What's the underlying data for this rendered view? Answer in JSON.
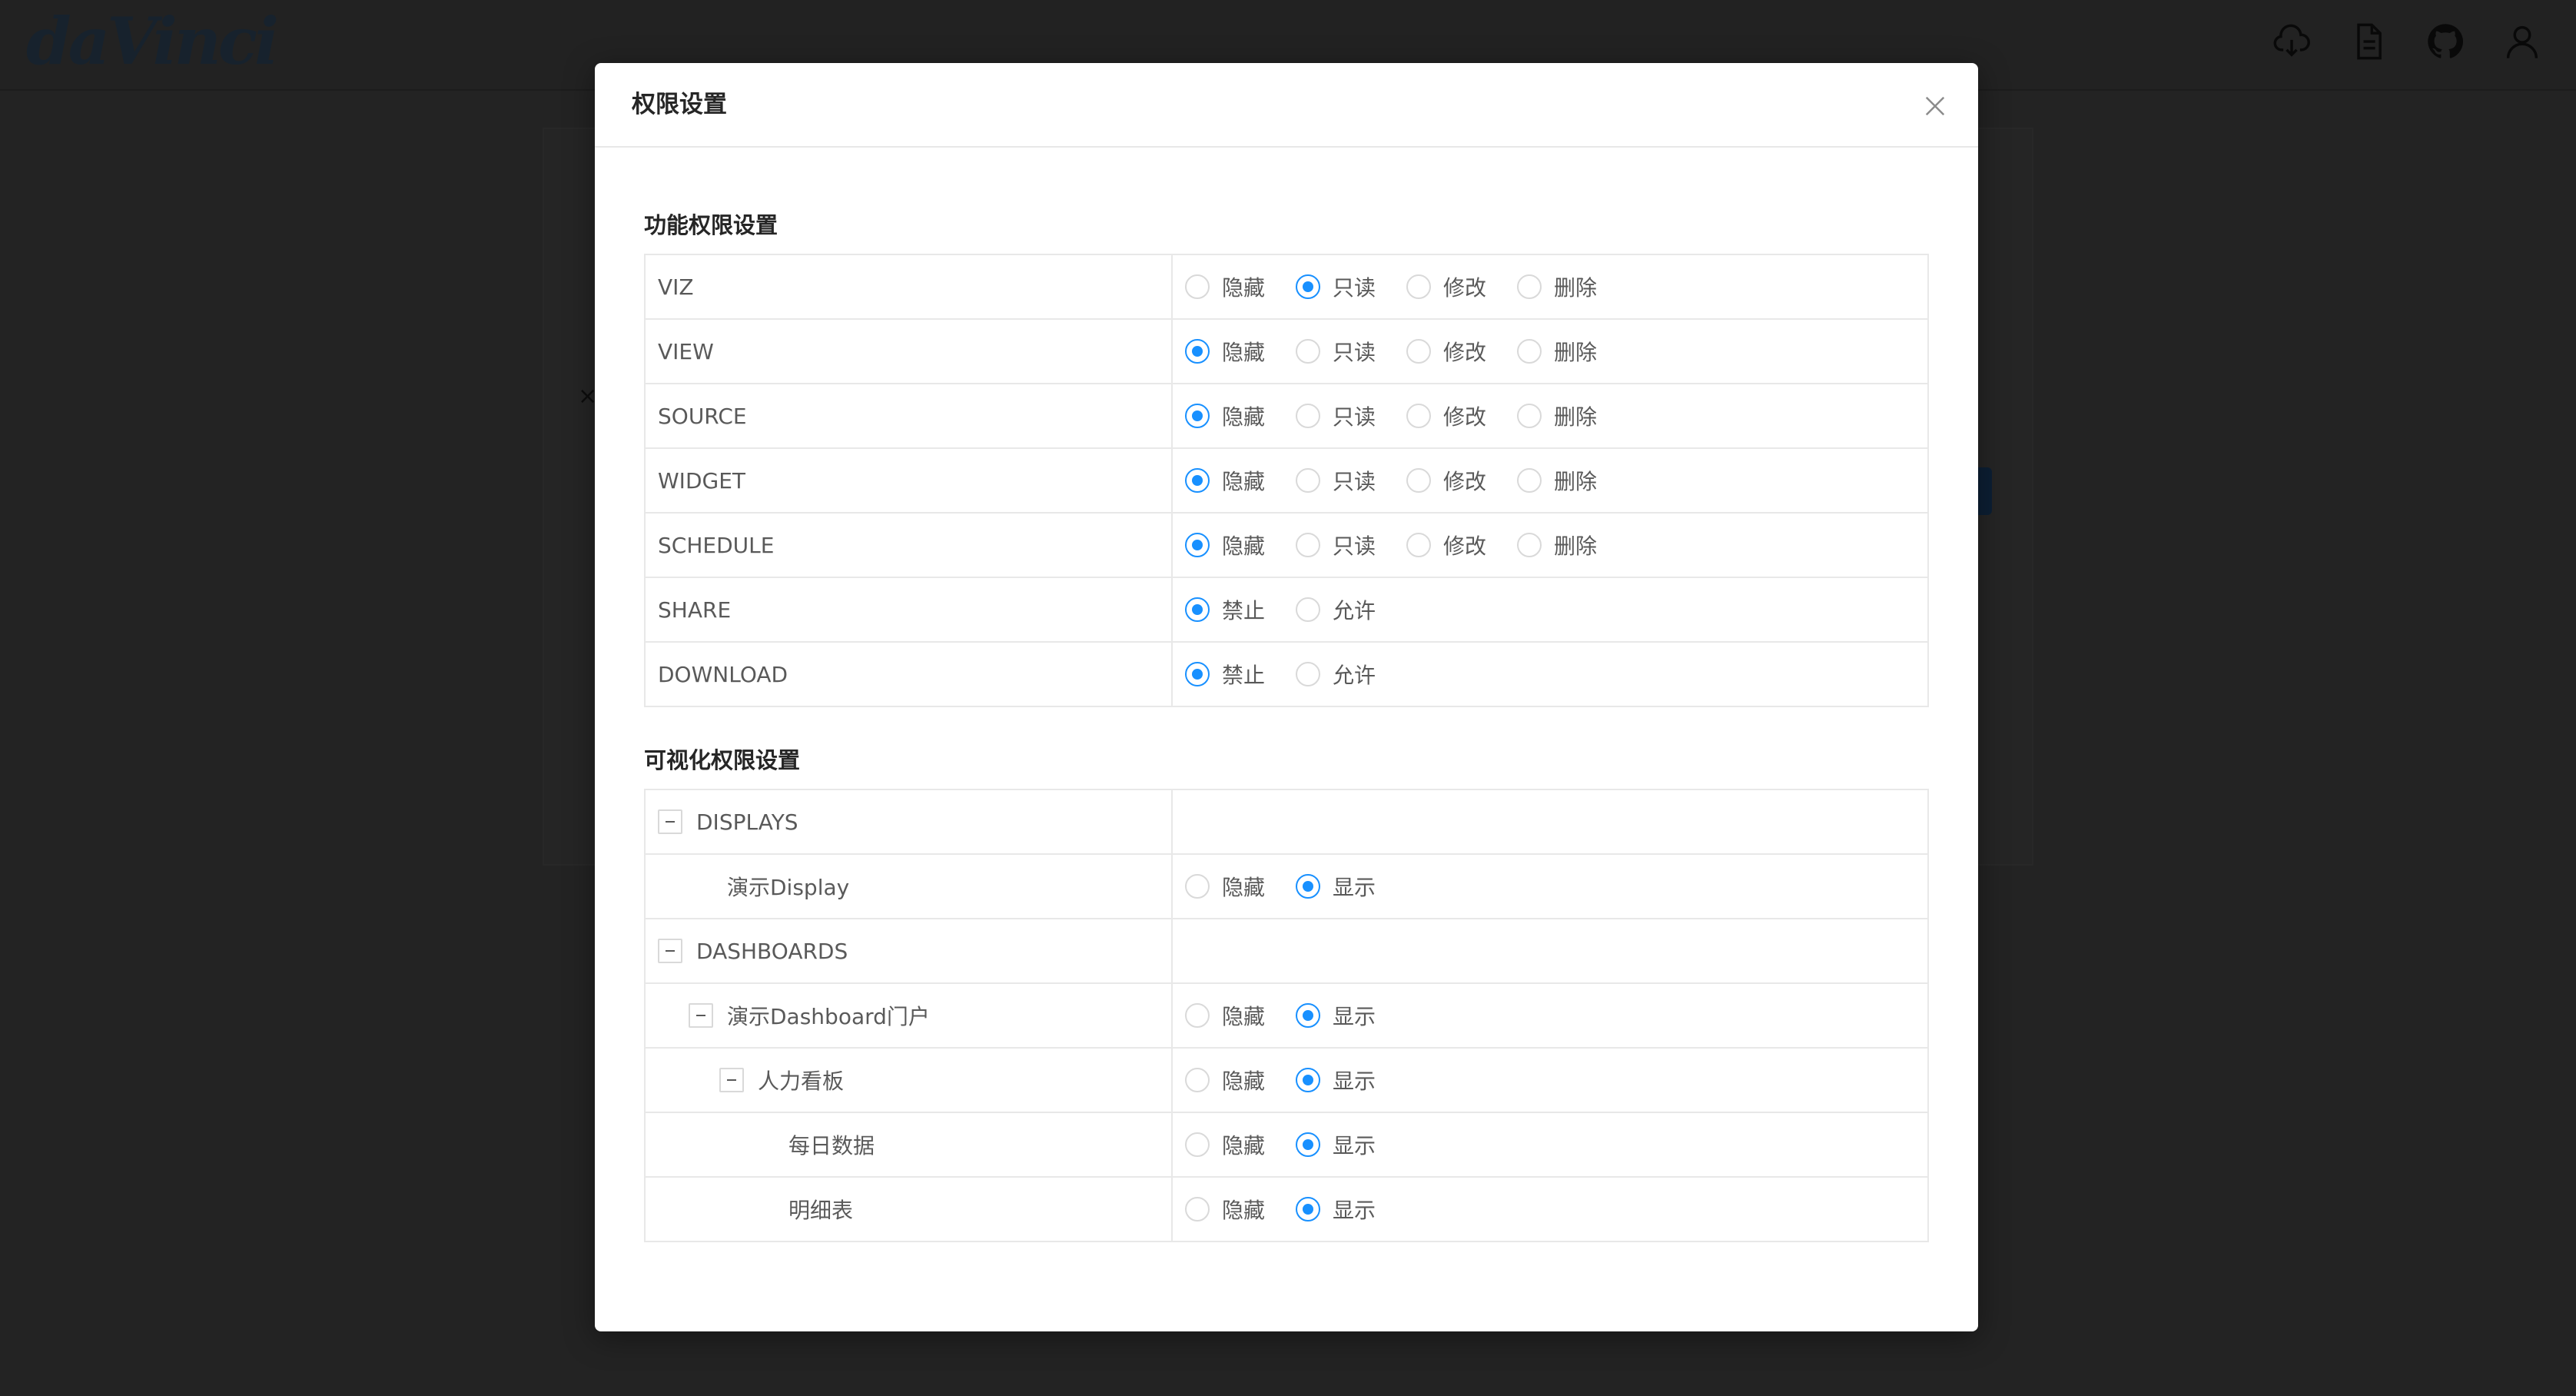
{
  "app": {
    "logo_text": "daVinci"
  },
  "header_icons": [
    "cloud-download-icon",
    "file-icon",
    "github-icon",
    "user-icon"
  ],
  "modal": {
    "title": "权限设置",
    "functional": {
      "title": "功能权限设置",
      "rows": [
        {
          "name": "VIZ",
          "options": [
            "隐藏",
            "只读",
            "修改",
            "删除"
          ],
          "selected": 1
        },
        {
          "name": "VIEW",
          "options": [
            "隐藏",
            "只读",
            "修改",
            "删除"
          ],
          "selected": 0
        },
        {
          "name": "SOURCE",
          "options": [
            "隐藏",
            "只读",
            "修改",
            "删除"
          ],
          "selected": 0
        },
        {
          "name": "WIDGET",
          "options": [
            "隐藏",
            "只读",
            "修改",
            "删除"
          ],
          "selected": 0
        },
        {
          "name": "SCHEDULE",
          "options": [
            "隐藏",
            "只读",
            "修改",
            "删除"
          ],
          "selected": 0
        },
        {
          "name": "SHARE",
          "options": [
            "禁止",
            "允许"
          ],
          "selected": 0
        },
        {
          "name": "DOWNLOAD",
          "options": [
            "禁止",
            "允许"
          ],
          "selected": 0
        }
      ]
    },
    "visual": {
      "title": "可视化权限设置",
      "rows": [
        {
          "name": "DISPLAYS",
          "level": 0,
          "expandable": true,
          "options": [],
          "selected": -1
        },
        {
          "name": "演示Display",
          "level": 1,
          "expandable": false,
          "options": [
            "隐藏",
            "显示"
          ],
          "selected": 1
        },
        {
          "name": "DASHBOARDS",
          "level": 0,
          "expandable": true,
          "options": [],
          "selected": -1
        },
        {
          "name": "演示Dashboard门户",
          "level": 1,
          "expandable": true,
          "options": [
            "隐藏",
            "显示"
          ],
          "selected": 1
        },
        {
          "name": "人力看板",
          "level": 2,
          "expandable": true,
          "options": [
            "隐藏",
            "显示"
          ],
          "selected": 1
        },
        {
          "name": "每日数据",
          "level": 3,
          "expandable": false,
          "options": [
            "隐藏",
            "显示"
          ],
          "selected": 1
        },
        {
          "name": "明细表",
          "level": 3,
          "expandable": false,
          "options": [
            "隐藏",
            "显示"
          ],
          "selected": 1
        }
      ]
    }
  },
  "colors": {
    "primary": "#1890ff",
    "border": "#e8e8e8",
    "mask": "#2b2b2b"
  }
}
